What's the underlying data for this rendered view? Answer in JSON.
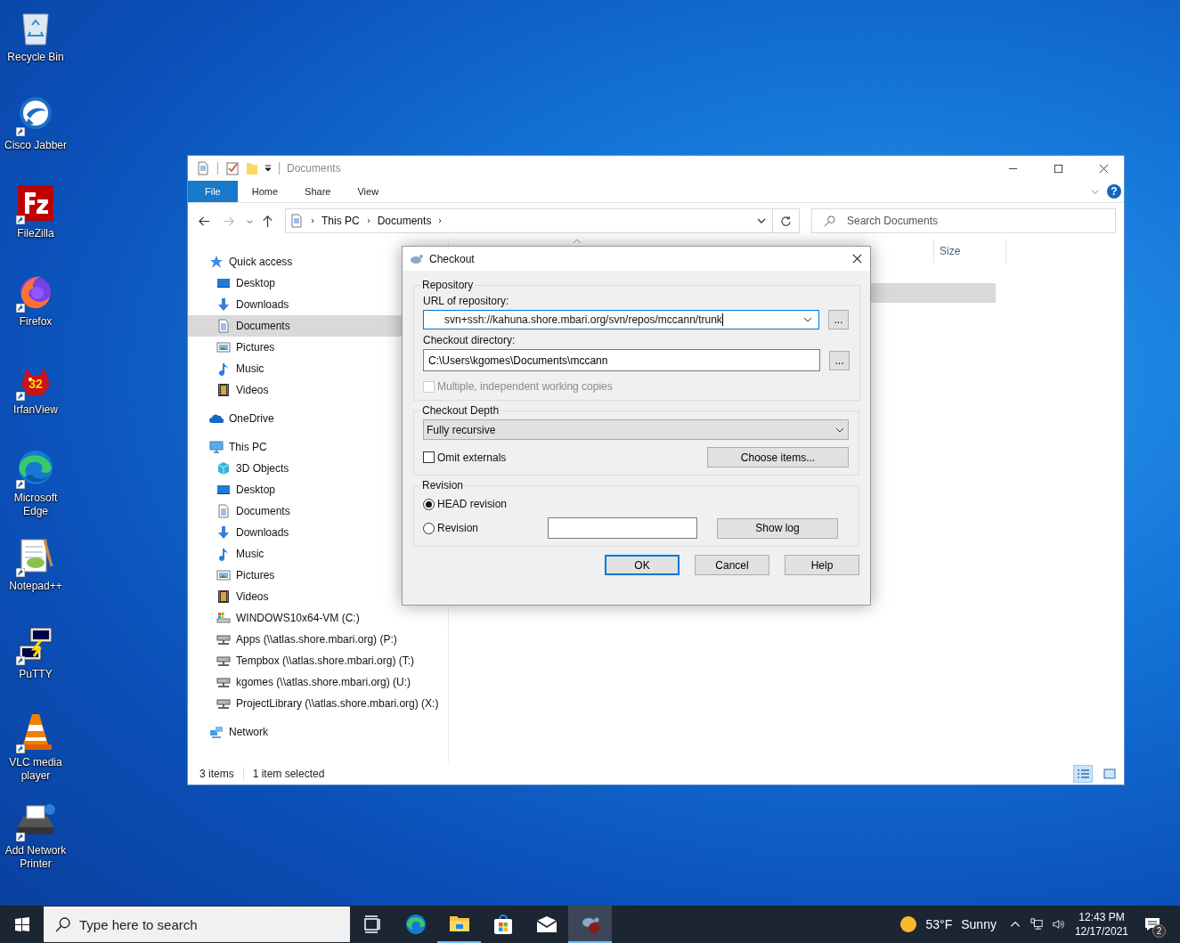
{
  "desktop_icons": [
    {
      "kind": "recycle",
      "label": "Recycle Bin",
      "shortcut": false
    },
    {
      "kind": "jabber",
      "label": "Cisco Jabber",
      "shortcut": true
    },
    {
      "kind": "filezilla",
      "label": "FileZilla",
      "shortcut": true
    },
    {
      "kind": "firefox",
      "label": "Firefox",
      "shortcut": true
    },
    {
      "kind": "irfanview",
      "label": "IrfanView",
      "shortcut": true,
      "badge": "32"
    },
    {
      "kind": "edge",
      "label": "Microsoft Edge",
      "shortcut": true
    },
    {
      "kind": "notepad",
      "label": "Notepad++",
      "shortcut": true
    },
    {
      "kind": "putty",
      "label": "PuTTY",
      "shortcut": true
    },
    {
      "kind": "vlc",
      "label": "VLC media player",
      "shortcut": true
    },
    {
      "kind": "printer",
      "label": "Add Network Printer",
      "shortcut": true
    }
  ],
  "explorer": {
    "title": "Documents",
    "ribbon_tabs": [
      {
        "label": "File",
        "selected": true
      },
      {
        "label": "Home",
        "selected": false
      },
      {
        "label": "Share",
        "selected": false
      },
      {
        "label": "View",
        "selected": false
      }
    ],
    "help": "?",
    "breadcrumbs": [
      "This PC",
      "Documents"
    ],
    "search": {
      "placeholder": "Search Documents"
    },
    "nav": [
      {
        "kind": "quick",
        "label": "Quick access",
        "selected": false,
        "children": [
          {
            "kind": "desktop",
            "label": "Desktop",
            "selected": false
          },
          {
            "kind": "downloads",
            "label": "Downloads",
            "selected": false
          },
          {
            "kind": "documents",
            "label": "Documents",
            "selected": true
          },
          {
            "kind": "pictures",
            "label": "Pictures",
            "selected": false
          },
          {
            "kind": "music",
            "label": "Music",
            "selected": false
          },
          {
            "kind": "videos",
            "label": "Videos",
            "selected": false
          }
        ]
      },
      {
        "kind": "onedrive",
        "label": "OneDrive",
        "selected": false
      },
      {
        "kind": "pc",
        "label": "This PC",
        "selected": false,
        "children": [
          {
            "kind": "objects3d",
            "label": "3D Objects",
            "selected": false
          },
          {
            "kind": "desktop",
            "label": "Desktop",
            "selected": false
          },
          {
            "kind": "documents",
            "label": "Documents",
            "selected": false
          },
          {
            "kind": "downloads",
            "label": "Downloads",
            "selected": false
          },
          {
            "kind": "music",
            "label": "Music",
            "selected": false
          },
          {
            "kind": "pictures",
            "label": "Pictures",
            "selected": false
          },
          {
            "kind": "videos",
            "label": "Videos",
            "selected": false
          },
          {
            "kind": "drive",
            "label": "WINDOWS10x64-VM (C:)",
            "selected": false
          },
          {
            "kind": "netdrive",
            "label": "Apps (\\\\atlas.shore.mbari.org) (P:)",
            "selected": false
          },
          {
            "kind": "netdrive",
            "label": "Tempbox (\\\\atlas.shore.mbari.org) (T:)",
            "selected": false
          },
          {
            "kind": "netdrive",
            "label": "kgomes (\\\\atlas.shore.mbari.org) (U:)",
            "selected": false
          },
          {
            "kind": "netdrive",
            "label": "ProjectLibrary (\\\\atlas.shore.mbari.org) (X:)",
            "selected": false
          }
        ]
      },
      {
        "kind": "network",
        "label": "Network",
        "selected": false
      }
    ],
    "columns": [
      "Size"
    ],
    "file_rows": [
      {
        "selected": false
      },
      {
        "selected": true
      },
      {
        "selected": false
      }
    ],
    "status": {
      "count": "3 items",
      "selection": "1 item selected"
    },
    "view_buttons": [
      {
        "kind": "details",
        "selected": true
      },
      {
        "kind": "large",
        "selected": false
      }
    ]
  },
  "dialog": {
    "title": "Checkout",
    "repository": {
      "legend": "Repository",
      "url_label": "URL of repository:",
      "url_value": "svn+ssh://kahuna.shore.mbari.org/svn/repos/mccann/trunk",
      "browse": "...",
      "dir_label": "Checkout directory:",
      "dir_value": "C:\\Users\\kgomes\\Documents\\mccann",
      "dir_browse": "...",
      "multiple": {
        "label": "Multiple, independent working copies",
        "checked": false,
        "disabled": true
      }
    },
    "depth": {
      "legend": "Checkout Depth",
      "value": "Fully recursive",
      "omit": {
        "label": "Omit externals",
        "checked": false,
        "disabled": false
      },
      "choose": "Choose items..."
    },
    "revision": {
      "legend": "Revision",
      "options": [
        {
          "label": "HEAD revision",
          "selected": true
        },
        {
          "label": "Revision",
          "selected": false
        }
      ],
      "show_log": "Show log"
    },
    "buttons": [
      {
        "label": "OK",
        "default": true
      },
      {
        "label": "Cancel",
        "default": false
      },
      {
        "label": "Help",
        "default": false
      }
    ]
  },
  "taskbar": {
    "search": {
      "placeholder": "Type here to search"
    },
    "apps": [
      {
        "kind": "taskview",
        "running": false,
        "active": false
      },
      {
        "kind": "edge",
        "running": false,
        "active": false
      },
      {
        "kind": "explorer",
        "running": true,
        "active": false
      },
      {
        "kind": "store",
        "running": false,
        "active": false
      },
      {
        "kind": "mail",
        "running": false,
        "active": false
      },
      {
        "kind": "tortoise",
        "running": true,
        "active": true
      }
    ],
    "weather": {
      "temp": "53°F",
      "condition": "Sunny"
    },
    "time": "12:43 PM",
    "date": "12/17/2021",
    "notifications": "2"
  }
}
